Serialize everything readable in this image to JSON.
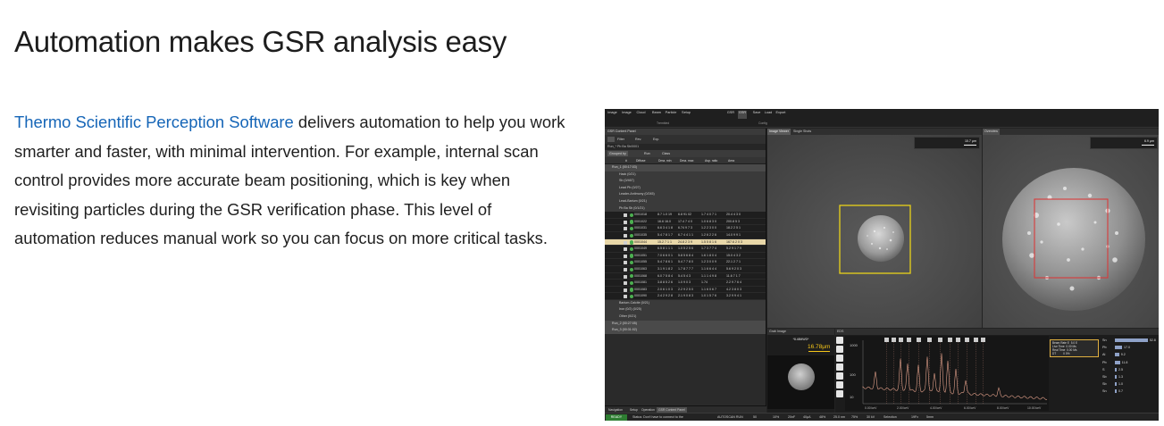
{
  "heading": "Automation makes GSR analysis easy",
  "intro": {
    "link_text": "Thermo Scientific Perception Software",
    "body_text": " delivers automation to help you work smarter and faster, with minimal intervention. For example, internal scan control provides more accurate beam positioning, which is key when revisiting particles during the GSR verification phase. This level of automation reduces manual work so you can focus on more critical tasks."
  },
  "colors": {
    "link": "#1565b7",
    "status_ready": "#2e7d32",
    "selection_row": "#e8d7a8",
    "roi_yellow": "#e9d21a",
    "roi_red": "#d83b3b",
    "spectrum_line": "#e2a08a"
  },
  "software": {
    "ribbon": {
      "items": [
        "Image",
        "Image",
        "Cloud",
        "Beam",
        "Particle",
        "Setup",
        "GSR",
        "GSR",
        "Save",
        "Load",
        "Export"
      ],
      "groups": [
        "Trembled",
        "Config"
      ]
    },
    "left_panel": {
      "title": "GSR Content Panel",
      "toolbar": [
        "Filter",
        "Rev.",
        "Exp."
      ],
      "path": "Run_* Pb Ba Sb/0001",
      "filter_buttons": [
        "Grouped by",
        "Run",
        "Class"
      ],
      "columns": [
        "#",
        "Diffuse",
        "Dma. min",
        "Dma. max",
        "Asp. ratio",
        "Area"
      ],
      "groups": [
        {
          "label": "Run_1 (00:17:03)",
          "type": "grp"
        },
        {
          "label": "Hack (0/21)",
          "type": "sub"
        },
        {
          "label": "Sb (0/467)",
          "type": "sub"
        },
        {
          "label": "Lead Pb (0/27)",
          "type": "sub"
        },
        {
          "label": "Leader-Antimony (0/245)",
          "type": "sub"
        },
        {
          "label": "Lead-Barium (0/21)",
          "type": "sub"
        },
        {
          "label": "Pb Ba Sb (0/1/21)",
          "type": "sub"
        }
      ],
      "rows": [
        [
          "0001018",
          "8.7 1.0 19",
          "6.8 91 02",
          "1.7 4 0 7 1",
          "20.4 4 3 0"
        ],
        [
          "0001022",
          "16.6 16.0",
          "17.4 7 4 0",
          "1.0 6 8 3 0",
          "200.8 5 3"
        ],
        [
          "0001031",
          "6.6 3 4 1 8",
          "6.74 9 7 3",
          "1.2 2 3 0 0",
          "18.2 2 5 1"
        ],
        [
          "0001035",
          "5.4 7 8 1 7",
          "6.7 4 4 1 1",
          "1.2 6 2 2 6",
          "14.0 9 9 1"
        ],
        [
          "0001044",
          "15.2 7 1 1",
          "24.8 2 3 9",
          "1.5 5 8 1 6",
          "167.6 2 0 3"
        ],
        [
          "0001049",
          "6.5 8 1 1 1",
          "1.0 5 2 5 6",
          "1.7 3 7 7 4",
          "5.2 9 1 7 9"
        ],
        [
          "0001051",
          "7.0 6 6 0 1",
          "5.8 5 6 8 4",
          "1.6 1 8 0 4",
          "15.0 4 3 2"
        ],
        [
          "0001055",
          "5.4 7 8 6 1",
          "5.4 7 7 8 0",
          "1.2 3 0 0 9",
          "22.1 2 7 1"
        ],
        [
          "0001063",
          "3.1 9 1 8 2",
          "1.7 8 7 7 7",
          "1.1 6 6 4 4",
          "5.6 9 2 0 3"
        ],
        [
          "0001068",
          "6.0 7 5 8 4",
          "5.4 5 4 3",
          "1.1 1 4 9 8",
          "11.6 7 1 7"
        ],
        [
          "0001081",
          "3.8 8 5 2 6",
          "1.0 9 0 3",
          "1.74",
          "2.2 9 7 6 4"
        ],
        [
          "0001083",
          "2.0 6 1 0 3",
          "2.2 9 2 5 0",
          "1.1 6 0 6 7",
          "4.2 3 8 0 3"
        ],
        [
          "0001090",
          "2.4 2 9 2 8",
          "2.1 9 0 8 3",
          "1.0 1 5 7 6",
          "3.2 9 9 4 1"
        ]
      ],
      "selected_row": 4,
      "footer_groups": [
        "Barium-Calcite (0/21)",
        "Iron (0/2) (0/25)",
        "Other (0/21)"
      ],
      "runs": [
        "Run_2 (00:27:05)",
        "Run_3 (00:31:02)"
      ],
      "tabs": [
        "Navigation",
        "Setup",
        "Operation",
        "GSR Content Panel"
      ]
    },
    "image_viewer": {
      "tabs": [
        "Image Viewer",
        "Single Shots"
      ],
      "scale_value": "10.7 μm"
    },
    "overview": {
      "tab": "Overview",
      "scale_value": "6.9 μm"
    },
    "spot_image": {
      "tab": "Grab Image",
      "label": "*8.48MWD*",
      "scale_value": "16.78μm"
    },
    "eds": {
      "tab": "EDS",
      "info_box": "Beam Rate E  5.0 E\nLive Time  0.00 Ms\nReal Time  0.00 Ms\nDT         0 0%",
      "y_ticks": [
        "1000",
        "100",
        "10"
      ],
      "x_ticks": [
        "0.00 keV",
        "2.00 keV",
        "4.00 keV",
        "6.00 keV",
        "8.00 keV",
        "10.00 keV"
      ],
      "elements": [
        {
          "symbol": "Sn",
          "fraction": 0.92,
          "value": "52.8"
        },
        {
          "symbol": "Pb",
          "fraction": 0.2,
          "value": "17.0"
        },
        {
          "symbol": "Al",
          "fraction": 0.12,
          "value": "9.2"
        },
        {
          "symbol": "Pb",
          "fraction": 0.14,
          "value": "11.8"
        },
        {
          "symbol": "S",
          "fraction": 0.04,
          "value": "2.5"
        },
        {
          "symbol": "Sb",
          "fraction": 0.03,
          "value": "1.3"
        },
        {
          "symbol": "Sb",
          "fraction": 0.03,
          "value": "1.0"
        },
        {
          "symbol": "Sn",
          "fraction": 0.02,
          "value": "0.7"
        }
      ]
    },
    "status_bar": {
      "state": "READY",
      "message": "Status: Don't have to connect to the",
      "items": [
        "AUTOSCAN RUN",
        "50",
        "10%",
        "20nF",
        "40μA",
        "48%",
        "25.0 nm",
        "75%",
        "30 kV",
        "Selection",
        "19Fx",
        "5mm"
      ]
    }
  }
}
